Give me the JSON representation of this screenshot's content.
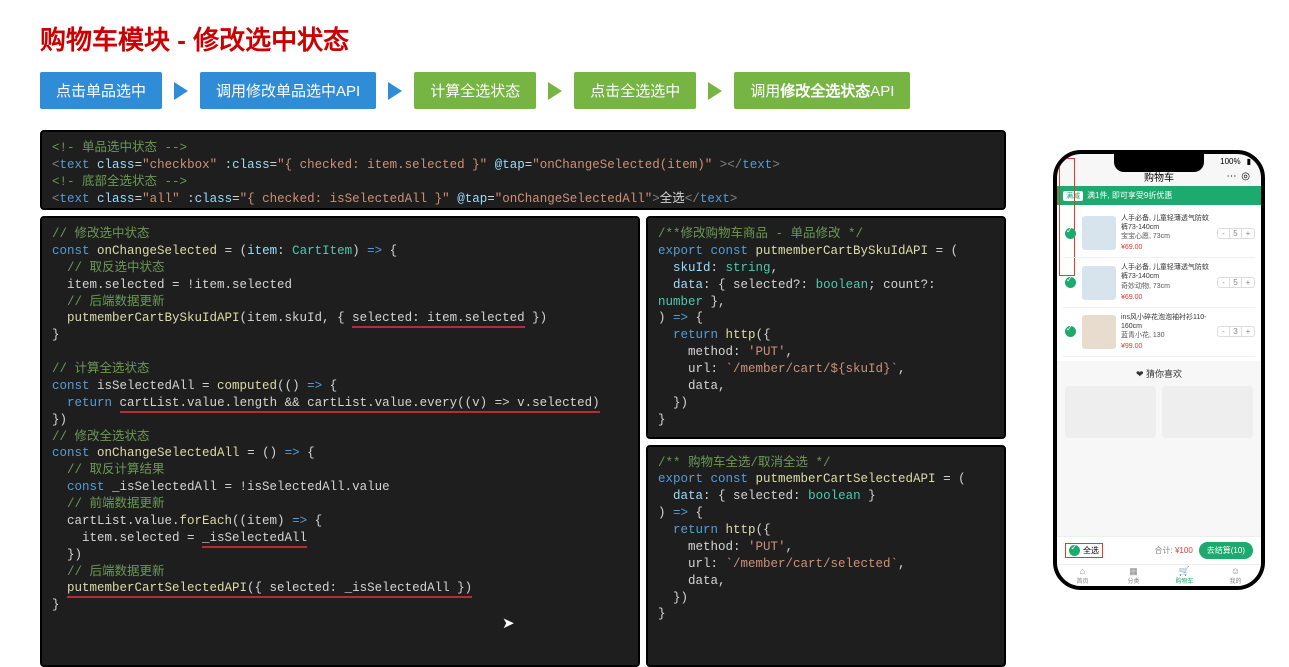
{
  "title": "购物车模块 - 修改选中状态",
  "flow": {
    "step1": "点击单品选中",
    "step2": "调用修改单品选中API",
    "step3": "计算全选状态",
    "step4": "点击全选选中",
    "step5_prefix": "调用",
    "step5_bold": "修改全选状态",
    "step5_suffix": "API"
  },
  "code_template": {
    "c1": "<!- 单品选中状态 -->",
    "l1a": "<text class=\"checkbox\" :class=\"{ checked: item.selected }\" @tap=\"onChangeSelected(item)\" ></text>",
    "c2": "<!- 底部全选状态 -->",
    "l2a": "<text class=\"all\" :class=\"{ checked: isSelectedAll }\" @tap=\"onChangeSelectedAll\">全选</text>"
  },
  "code_left": {
    "cm1": "// 修改选中状态",
    "l1": "const onChangeSelected = (item: CartItem) => {",
    "cm2": "  // 取反选中状态",
    "l2": "  item.selected = !item.selected",
    "cm3": "  // 后端数据更新",
    "l3": "  putmemberCartBySkuIdAPI(item.skuId, { selected: item.selected })",
    "l3_ul": "selected: item.selected",
    "l4": "}",
    "cm4": "// 计算全选状态",
    "l5": "const isSelectedAll = computed(() => {",
    "l6": "  return cartList.value.length && cartList.value.every((v) => v.selected)",
    "l6_ul": "cartList.value.length && cartList.value.every((v) => v.selected)",
    "l7": "})",
    "cm5": "// 修改全选状态",
    "l8": "const onChangeSelectedAll = () => {",
    "cm6": "  // 取反计算结果",
    "l9": "  const _isSelectedAll = !isSelectedAll.value",
    "cm7": "  // 前端数据更新",
    "l10": "  cartList.value.forEach((item) => {",
    "l11": "    item.selected = _isSelectedAll",
    "l11_ul": "_isSelectedAll",
    "l12": "  })",
    "cm8": "  // 后端数据更新",
    "l13": "  putmemberCartSelectedAPI({ selected: _isSelectedAll })",
    "l13_ul": "_isSelectedAll",
    "l14": "}"
  },
  "code_r1": {
    "cm1": "/**修改购物车商品 - 单品修改 */",
    "l1": "export const putmemberCartBySkuIdAPI = (",
    "l2": "  skuId: string,",
    "l3": "  data: { selected?: boolean; count?:",
    "l3b": "number },",
    "l4": ") => {",
    "l5": "  return http({",
    "l6": "    method: 'PUT',",
    "l7": "    url: `/member/cart/${skuId}`,",
    "l8": "    data,",
    "l9": "  })",
    "l10": "}"
  },
  "code_r2": {
    "cm1": "/** 购物车全选/取消全选 */",
    "l1": "export const putmemberCartSelectedAPI = (",
    "l2": "  data: { selected: boolean }",
    "l3": ") => {",
    "l4": "  return http({",
    "l5": "    method: 'PUT',",
    "l6": "    url: `/member/cart/selected`,",
    "l7": "    data,",
    "l8": "  })",
    "l9": "}"
  },
  "phone": {
    "status_pct": "100%",
    "title": "购物车",
    "banner_tag": "满减",
    "banner_text": "满1件, 即可享受9折优惠",
    "items": [
      {
        "title": "人手必备, 儿童轻薄透气防蚊裤73-140cm",
        "spec": "宝宝心愿, 73cm",
        "price": "¥69.00",
        "qty": "5"
      },
      {
        "title": "人手必备, 儿童轻薄透气防蚊裤73-140cm",
        "spec": "奇妙动物, 73cm",
        "price": "¥69.00",
        "qty": "5"
      },
      {
        "title": "ins风小碎花泡泡袖衬衫110-160cm",
        "spec": "蓝青小花, 130",
        "price": "¥99.00",
        "qty": "3"
      }
    ],
    "guess": "猜你喜欢",
    "all_label": "全选",
    "total_label": "合计:",
    "total_value": "¥100",
    "checkout": "去结算(10)",
    "tabs": {
      "home": "首页",
      "cat": "分类",
      "cart": "购物车",
      "me": "我的"
    }
  }
}
